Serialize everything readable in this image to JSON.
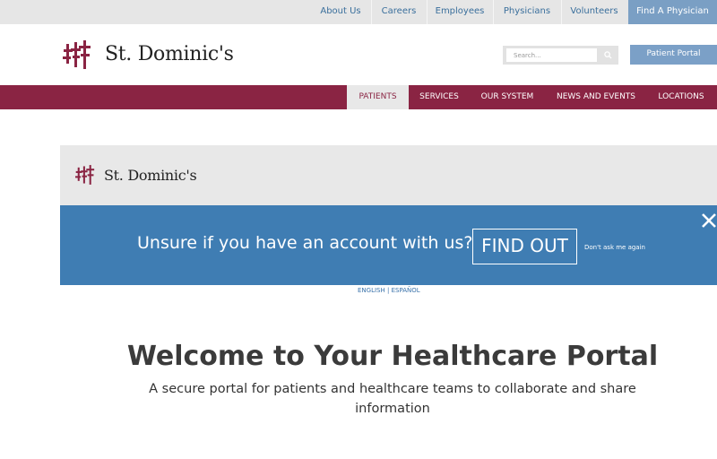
{
  "colors": {
    "brand_maroon": "#8a2443",
    "portal_blue": "#3f7db3",
    "link_blue": "#3a6f9c",
    "button_blue": "#7ba0c7"
  },
  "utility_nav": {
    "items": [
      "About Us",
      "Careers",
      "Employees",
      "Physicians",
      "Volunteers"
    ],
    "cta": "Find A Physician"
  },
  "header": {
    "brand": "St. Dominic's",
    "logo_icon": "st-dominics-cross-logo",
    "search_placeholder": "Search...",
    "search_icon": "search-icon",
    "portal_button": "Patient Portal"
  },
  "main_nav": {
    "items": [
      "PATIENTS",
      "SERVICES",
      "OUR SYSTEM",
      "NEWS AND EVENTS",
      "LOCATIONS"
    ],
    "active": "PATIENTS"
  },
  "portal": {
    "logo_text": "St. Dominic's",
    "banner_text": "Unsure if you have an account with us?",
    "find_out": "FIND OUT",
    "dont_ask": "Don't ask me again",
    "close_icon": "close-icon",
    "lang_english": "ENGLISH",
    "lang_sep": "|",
    "lang_spanish": "ESPAÑOL",
    "title": "Welcome to Your Healthcare Portal",
    "subtitle": "A secure portal for patients and healthcare teams to collaborate and share information"
  }
}
